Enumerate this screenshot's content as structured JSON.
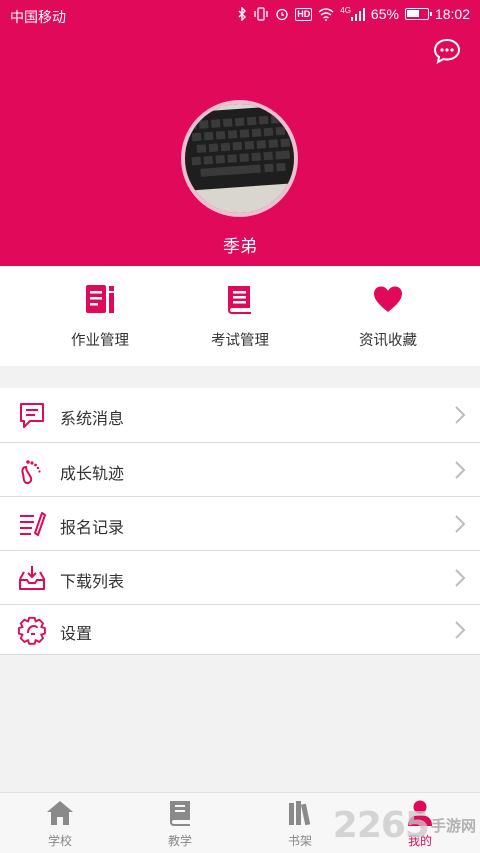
{
  "status_bar": {
    "carrier": "中国移动",
    "battery_percent": "65%",
    "battery_level": 0.65,
    "time": "18:02",
    "signal_label": "4G",
    "hd_label": "HD"
  },
  "header": {
    "username": "季弟",
    "color": "#e0095a"
  },
  "quick_actions": [
    {
      "label": "作业管理",
      "icon": "homework-icon"
    },
    {
      "label": "考试管理",
      "icon": "exam-book-icon"
    },
    {
      "label": "资讯收藏",
      "icon": "heart-icon"
    }
  ],
  "menu": [
    {
      "label": "系统消息",
      "icon": "message-icon"
    },
    {
      "label": "成长轨迹",
      "icon": "footprint-icon"
    },
    {
      "label": "报名记录",
      "icon": "record-icon"
    },
    {
      "label": "下载列表",
      "icon": "download-icon"
    },
    {
      "label": "设置",
      "icon": "gear-icon"
    }
  ],
  "tabs": [
    {
      "label": "学校",
      "icon": "home-icon",
      "active": false
    },
    {
      "label": "教学",
      "icon": "book-icon",
      "active": false
    },
    {
      "label": "书架",
      "icon": "bookshelf-icon",
      "active": false
    },
    {
      "label": "我的",
      "icon": "user-icon",
      "active": true
    }
  ],
  "watermark": {
    "number": "2265",
    "site": "手游网"
  }
}
